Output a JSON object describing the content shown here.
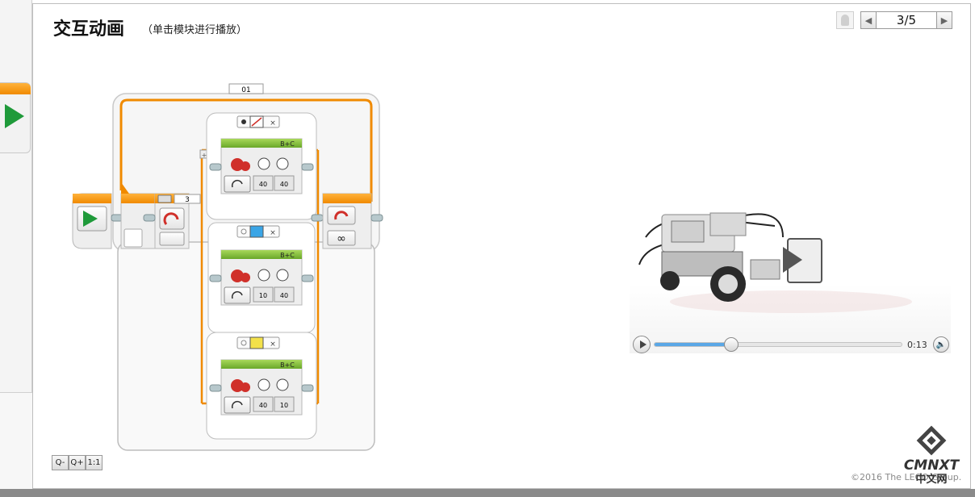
{
  "header": {
    "title": "交互动画",
    "subtitle": "（单击模块进行播放）"
  },
  "pager": {
    "label": "3/5",
    "prev_icon": "triangle-left-icon",
    "next_icon": "triangle-right-icon",
    "profile_icon": "user-icon"
  },
  "program": {
    "loop_label": "01",
    "loop_counter": "3",
    "switch_cases": [
      {
        "port_label": "B+C",
        "value1": "40",
        "value2": "40",
        "case_icon": "no-color-icon"
      },
      {
        "port_label": "B+C",
        "value1": "10",
        "value2": "40",
        "case_icon": "blue-color-icon"
      },
      {
        "port_label": "B+C",
        "value1": "40",
        "value2": "10",
        "case_icon": "yellow-color-icon"
      }
    ],
    "case_colors": {
      "blue": "#3aa5e6",
      "yellow": "#f3e14a",
      "orange": "#f08a00",
      "green": "#8cc63f"
    }
  },
  "zoom": {
    "zoom_out_label": "Q-",
    "zoom_in_label": "Q+",
    "reset_label": "1:1"
  },
  "video": {
    "time": "0:13",
    "progress": 0.31
  },
  "footer": {
    "copyright": "©2016 The LEGO Group.",
    "logo_text": "CMNXT",
    "logo_subtext": "中文网"
  }
}
